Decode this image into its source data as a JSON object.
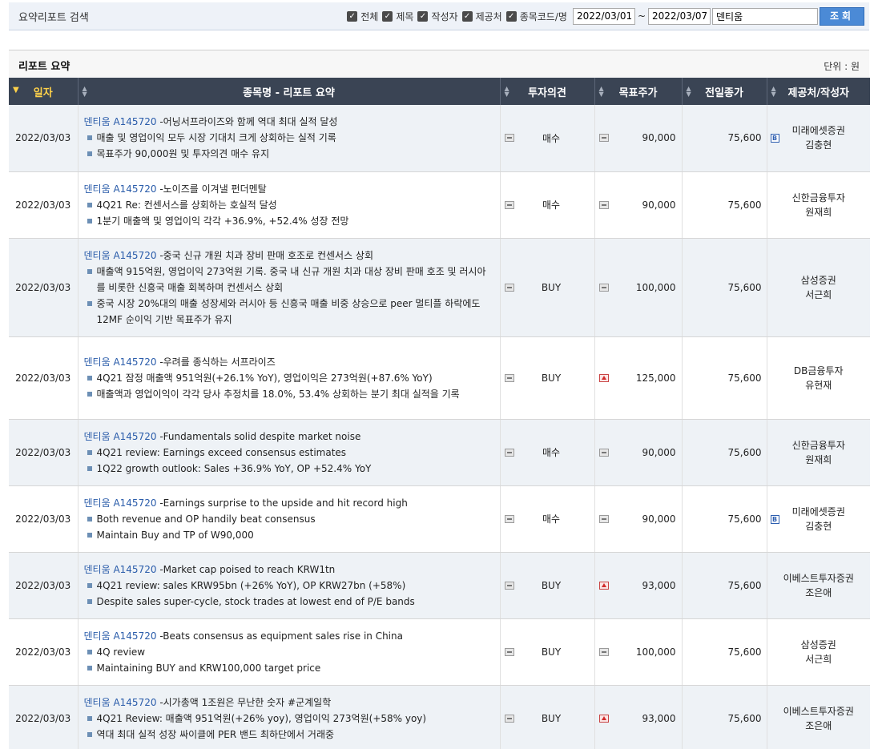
{
  "search": {
    "title": "요약리포트 검색",
    "checks": [
      {
        "label": "전체",
        "checked": true
      },
      {
        "label": "제목",
        "checked": true
      },
      {
        "label": "작성자",
        "checked": true
      },
      {
        "label": "제공처",
        "checked": true
      },
      {
        "label": "종목코드/명",
        "checked": true
      }
    ],
    "date_from": "2022/03/01",
    "tilde": "~",
    "date_to": "2022/03/07",
    "keyword": "덴티움",
    "button_label": "조회"
  },
  "section": {
    "title": "리포트 요약",
    "unit": "단위 : 원"
  },
  "columns": [
    "일자",
    "종목명 - 리포트 요약",
    "투자의견",
    "목표주가",
    "전일종가",
    "제공처/작성자"
  ],
  "rows": [
    {
      "date": "2022/03/03",
      "stock": "덴티움",
      "code": "A145720",
      "title": "-어닝서프라이즈와 함께 역대 최대 실적 달성",
      "bullets": [
        "매출 및 영업이익 모두 시장 기대치 크게 상회하는 실적 기록",
        "목표주가 90,000원 및 투자의견 매수 유지"
      ],
      "opinion": "매수",
      "target_icon": "flat",
      "target": "90,000",
      "prev_close": "75,600",
      "provider": "미래에셋증권",
      "author": "김충현",
      "badge": "B"
    },
    {
      "date": "2022/03/03",
      "stock": "덴티움",
      "code": "A145720",
      "title": "-노이즈를 이겨낼 펀더멘탈",
      "bullets": [
        "4Q21 Re: 컨센서스를 상회하는 호실적 달성",
        "1분기 매출액 및 영업이익 각각 +36.9%, +52.4% 성장 전망"
      ],
      "opinion": "매수",
      "target_icon": "flat",
      "target": "90,000",
      "prev_close": "75,600",
      "provider": "신한금융투자",
      "author": "원재희",
      "badge": ""
    },
    {
      "date": "2022/03/03",
      "stock": "덴티움",
      "code": "A145720",
      "title": "-중국 신규 개원 치과 장비 판매 호조로 컨센서스 상회",
      "bullets": [
        "매출액 915억원, 영업이익 273억원 기록. 중국 내 신규 개원 치과 대상 장비 판매 호조 및 러시아를 비롯한 신흥국 매출 회복하며 컨센서스 상회",
        "중국 시장 20%대의 매출 성장세와 러시아 등 신흥국 매출 비중 상승으로 peer 멀티플 하락에도 12MF 순이익 기반 목표주가 유지"
      ],
      "opinion": "BUY",
      "target_icon": "flat",
      "target": "100,000",
      "prev_close": "75,600",
      "provider": "삼성증권",
      "author": "서근희",
      "badge": ""
    },
    {
      "date": "2022/03/03",
      "stock": "덴티움",
      "code": "A145720",
      "title": "-우려를 종식하는 서프라이즈",
      "bullets": [
        "4Q21 잠정 매출액 951억원(+26.1% YoY), 영업이익은 273억원(+87.6% YoY)",
        "매출액과 영업이익이 각각 당사 추정치를 18.0%, 53.4% 상회하는 분기 최대 실적을 기록"
      ],
      "opinion": "BUY",
      "target_icon": "up",
      "target": "125,000",
      "prev_close": "75,600",
      "provider": "DB금융투자",
      "author": "유현재",
      "badge": ""
    },
    {
      "date": "2022/03/03",
      "stock": "덴티움",
      "code": "A145720",
      "title": "-Fundamentals solid despite market noise",
      "bullets": [
        "4Q21 review: Earnings exceed consensus estimates",
        "1Q22 growth outlook: Sales +36.9% YoY, OP +52.4% YoY"
      ],
      "opinion": "매수",
      "target_icon": "flat",
      "target": "90,000",
      "prev_close": "75,600",
      "provider": "신한금융투자",
      "author": "원재희",
      "badge": ""
    },
    {
      "date": "2022/03/03",
      "stock": "덴티움",
      "code": "A145720",
      "title": "-Earnings surprise to the upside and hit record high",
      "bullets": [
        "Both revenue and OP handily beat consensus",
        "Maintain Buy and TP of W90,000"
      ],
      "opinion": "매수",
      "target_icon": "flat",
      "target": "90,000",
      "prev_close": "75,600",
      "provider": "미래에셋증권",
      "author": "김충현",
      "badge": "B"
    },
    {
      "date": "2022/03/03",
      "stock": "덴티움",
      "code": "A145720",
      "title": "-Market cap poised to reach KRW1tn",
      "bullets": [
        "4Q21 review: sales KRW95bn (+26% YoY), OP KRW27bn (+58%)",
        "Despite sales super-cycle, stock trades at lowest end of P/E bands"
      ],
      "opinion": "BUY",
      "target_icon": "up",
      "target": "93,000",
      "prev_close": "75,600",
      "provider": "이베스트투자증권",
      "author": "조은애",
      "badge": ""
    },
    {
      "date": "2022/03/03",
      "stock": "덴티움",
      "code": "A145720",
      "title": "-Beats consensus as equipment sales rise in China",
      "bullets": [
        "4Q review",
        "Maintaining BUY and KRW100,000 target price"
      ],
      "opinion": "BUY",
      "target_icon": "flat",
      "target": "100,000",
      "prev_close": "75,600",
      "provider": "삼성증권",
      "author": "서근희",
      "badge": ""
    },
    {
      "date": "2022/03/03",
      "stock": "덴티움",
      "code": "A145720",
      "title": "-시가총액 1조원은 무난한 숫자 #군계일학",
      "bullets": [
        "4Q21 Review: 매출액 951억원(+26% yoy), 영업이익 273억원(+58% yoy)",
        "역대 최대 실적 성장 싸이클에 PER 밴드 최하단에서 거래중"
      ],
      "opinion": "BUY",
      "target_icon": "up",
      "target": "93,000",
      "prev_close": "75,600",
      "provider": "이베스트투자증권",
      "author": "조은애",
      "badge": ""
    }
  ]
}
